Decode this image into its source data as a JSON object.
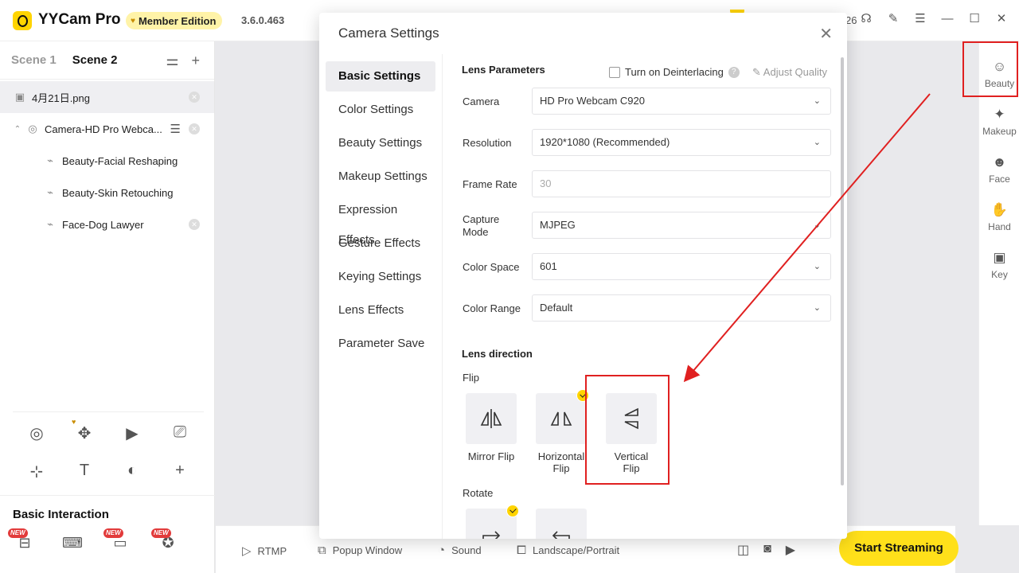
{
  "titlebar": {
    "app_name": "YYCam Pro",
    "member_label": "Member Edition",
    "version": "3.6.0.463",
    "count": "26"
  },
  "scenes": {
    "tabs": [
      "Scene 1",
      "Scene 2"
    ],
    "active": "Scene 2"
  },
  "sources": [
    {
      "label": "4月21日.png",
      "icon": "image-icon"
    },
    {
      "label": "Camera-HD Pro Webca...",
      "icon": "camera-icon"
    },
    {
      "label": "Beauty-Facial Reshaping",
      "icon": "effect-icon"
    },
    {
      "label": "Beauty-Skin Retouching",
      "icon": "effect-icon"
    },
    {
      "label": "Face-Dog Lawyer",
      "icon": "effect-icon"
    }
  ],
  "basic_interaction": {
    "title": "Basic Interaction",
    "new_badge": "NEW"
  },
  "bottombar": {
    "rtmp": "RTMP",
    "popup": "Popup Window",
    "sound": "Sound",
    "orientation": "Landscape/Portrait",
    "start": "Start Streaming"
  },
  "rightbar": [
    "Beauty",
    "Makeup",
    "Face",
    "Hand",
    "Key"
  ],
  "dialog": {
    "title": "Camera Settings",
    "nav": [
      "Basic Settings",
      "Color Settings",
      "Beauty Settings",
      "Makeup Settings",
      "Expression Effects",
      "Gesture Effects",
      "Keying Settings",
      "Lens Effects",
      "Parameter Save"
    ],
    "active_nav": "Basic Settings",
    "lens_params_title": "Lens Parameters",
    "deinterlace_label": "Turn on Deinterlacing",
    "adjust_quality": "Adjust Quality",
    "fields": [
      {
        "label": "Camera",
        "value": "HD Pro Webcam C920",
        "dropdown": true
      },
      {
        "label": "Resolution",
        "value": "1920*1080 (Recommended)",
        "dropdown": true
      },
      {
        "label": "Frame Rate",
        "value": "30",
        "dropdown": false
      },
      {
        "label": "Capture Mode",
        "value": "MJPEG",
        "dropdown": true
      },
      {
        "label": "Color Space",
        "value": "601",
        "dropdown": true
      },
      {
        "label": "Color Range",
        "value": "Default",
        "dropdown": true
      }
    ],
    "lens_direction_title": "Lens direction",
    "flip_label": "Flip",
    "flip_options": [
      {
        "line1": "Mirror Flip",
        "line2": ""
      },
      {
        "line1": "Horizontal",
        "line2": "Flip"
      },
      {
        "line1": "Vertical",
        "line2": "Flip"
      }
    ],
    "flip_selected": "Horizontal Flip",
    "rotate_label": "Rotate"
  },
  "colors": {
    "accent_yellow": "#ffe01a",
    "annotation_red": "#e02020"
  }
}
